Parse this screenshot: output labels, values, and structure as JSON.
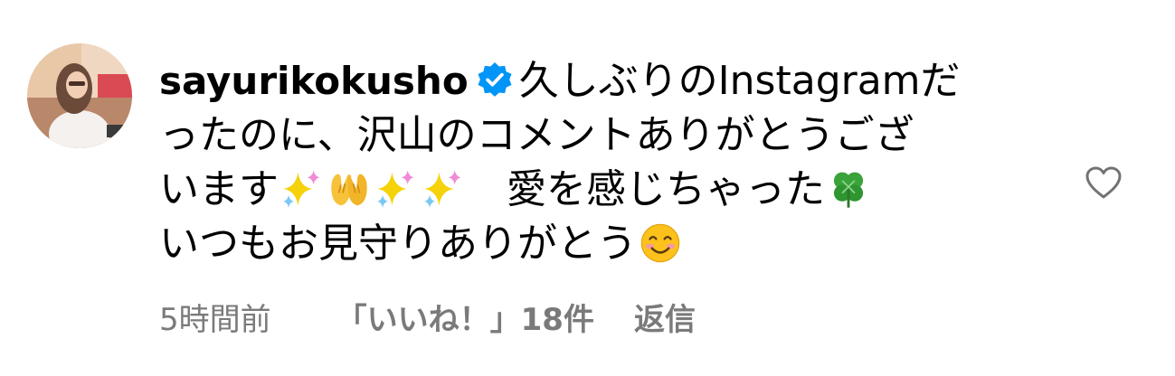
{
  "comment": {
    "username": "sayurikokusho",
    "text_line1": "久しぶりのInstagramだ",
    "text_line2": "ったのに、沢山のコメントありがとうござ",
    "text_line3a": "います",
    "text_line3b": "　愛を感じちゃった",
    "text_line4": "いつもお見守りありがとう",
    "emojis": [
      "sparkles-icon",
      "palms-up-together-icon",
      "sparkles-icon",
      "sparkles-icon",
      "four-leaf-clover-icon",
      "smiling-face-icon"
    ],
    "time_ago": "5時間前",
    "likes_label": "「いいね！」18件",
    "reply_label": "返信"
  },
  "colors": {
    "verified_badge": "#0095f6",
    "meta_text": "#7a7a7a",
    "heart_outline": "#737373"
  }
}
